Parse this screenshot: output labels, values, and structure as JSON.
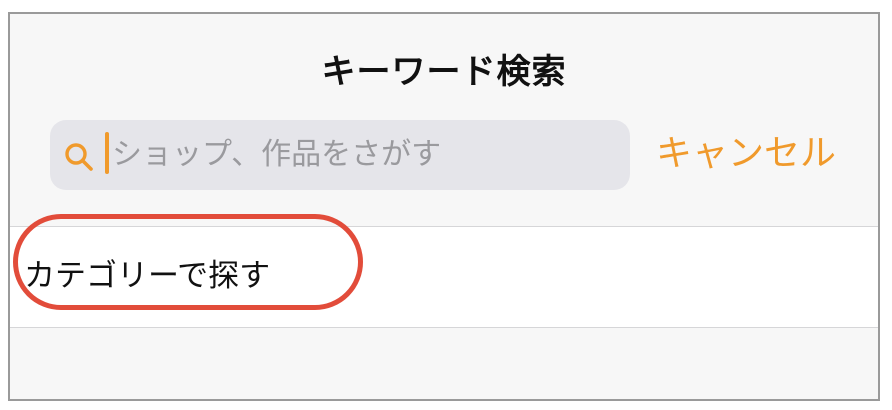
{
  "header": {
    "title": "キーワード検索"
  },
  "search": {
    "placeholder": "ショップ、作品をさがす",
    "icon": "search-icon",
    "cancel_label": "キャンセル"
  },
  "list": {
    "items": [
      {
        "label": "カテゴリーで探す",
        "highlighted": true
      }
    ]
  },
  "colors": {
    "accent": "#f09a2c",
    "highlight_ring": "#e24c3a",
    "search_field_bg": "#e5e5ea",
    "header_bg": "#f7f7f7"
  }
}
